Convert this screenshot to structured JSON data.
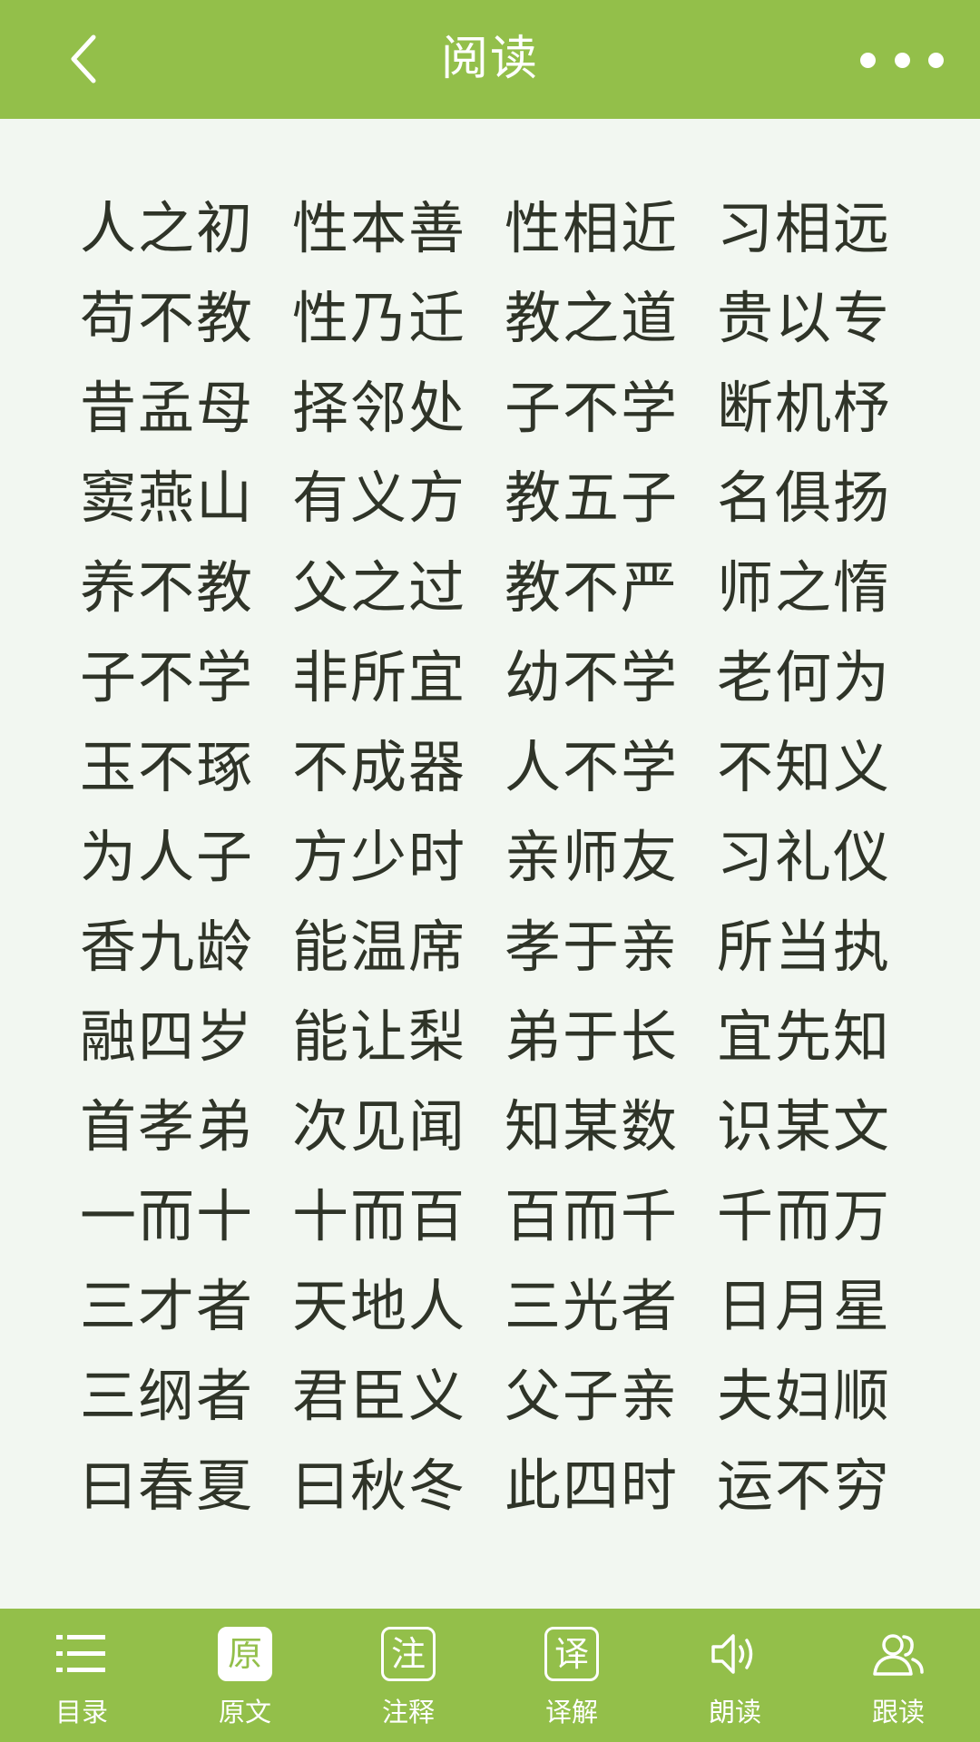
{
  "header": {
    "title": "阅读"
  },
  "verses": [
    [
      "人之初",
      "性本善",
      "性相近",
      "习相远"
    ],
    [
      "苟不教",
      "性乃迁",
      "教之道",
      "贵以专"
    ],
    [
      "昔孟母",
      "择邻处",
      "子不学",
      "断机杼"
    ],
    [
      "窦燕山",
      "有义方",
      "教五子",
      "名俱扬"
    ],
    [
      "养不教",
      "父之过",
      "教不严",
      "师之惰"
    ],
    [
      "子不学",
      "非所宜",
      "幼不学",
      "老何为"
    ],
    [
      "玉不琢",
      "不成器",
      "人不学",
      "不知义"
    ],
    [
      "为人子",
      "方少时",
      "亲师友",
      "习礼仪"
    ],
    [
      "香九龄",
      "能温席",
      "孝于亲",
      "所当执"
    ],
    [
      "融四岁",
      "能让梨",
      "弟于长",
      "宜先知"
    ],
    [
      "首孝弟",
      "次见闻",
      "知某数",
      "识某文"
    ],
    [
      "一而十",
      "十而百",
      "百而千",
      "千而万"
    ],
    [
      "三才者",
      "天地人",
      "三光者",
      "日月星"
    ],
    [
      "三纲者",
      "君臣义",
      "父子亲",
      "夫妇顺"
    ],
    [
      "曰春夏",
      "曰秋冬",
      "此四时",
      "运不穷"
    ]
  ],
  "footer": {
    "tabs": [
      {
        "label": "目录",
        "icon": "list-icon"
      },
      {
        "label": "原文",
        "icon": "original-text-icon",
        "glyph": "原",
        "active": true
      },
      {
        "label": "注释",
        "icon": "annotation-icon",
        "glyph": "注"
      },
      {
        "label": "译解",
        "icon": "translation-icon",
        "glyph": "译"
      },
      {
        "label": "朗读",
        "icon": "speaker-icon"
      },
      {
        "label": "跟读",
        "icon": "follow-read-icon"
      }
    ]
  },
  "colors": {
    "accent": "#93bf4a",
    "background": "#f2f7f1",
    "text": "#2f3428"
  }
}
